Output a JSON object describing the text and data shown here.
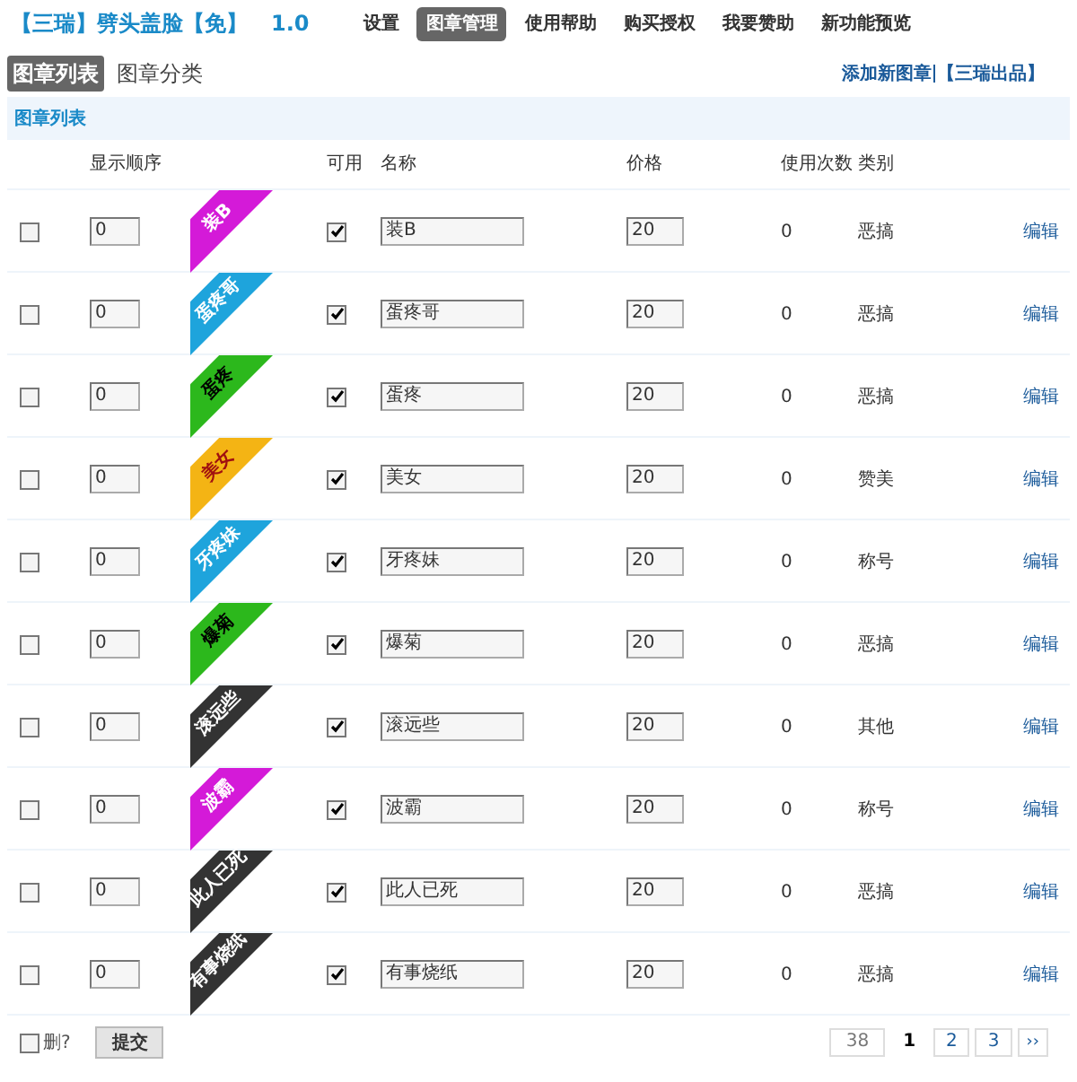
{
  "header": {
    "title": "【三瑞】劈头盖脸【免】",
    "version": "1.0",
    "nav": [
      {
        "label": "设置",
        "selected": false
      },
      {
        "label": "图章管理",
        "selected": true
      },
      {
        "label": "使用帮助",
        "selected": false
      },
      {
        "label": "购买授权",
        "selected": false
      },
      {
        "label": "我要赞助",
        "selected": false
      },
      {
        "label": "新功能预览",
        "selected": false
      }
    ]
  },
  "tabs": [
    {
      "label": "图章列表",
      "selected": true
    },
    {
      "label": "图章分类",
      "selected": false
    }
  ],
  "links": [
    "添加新图章",
    "【三瑞出品】"
  ],
  "section_title": "图章列表",
  "table": {
    "columns": [
      "显示顺序",
      "可用",
      "名称",
      "价格",
      "使用次数",
      "类别"
    ],
    "rows": [
      {
        "checked": false,
        "order": "0",
        "stamp": "装B",
        "color": "#d41ad8",
        "kind": "light",
        "enabled": true,
        "name": "装B",
        "price": "20",
        "uses": "0",
        "category": "恶搞",
        "action": "编辑"
      },
      {
        "checked": false,
        "order": "0",
        "stamp": "蛋疼哥",
        "color": "#1ea4dc",
        "kind": "light",
        "enabled": true,
        "name": "蛋疼哥",
        "price": "20",
        "uses": "0",
        "category": "恶搞",
        "action": "编辑"
      },
      {
        "checked": false,
        "order": "0",
        "stamp": "蛋疼",
        "color": "#2cb81c",
        "kind": "dark",
        "enabled": true,
        "name": "蛋疼",
        "price": "20",
        "uses": "0",
        "category": "恶搞",
        "action": "编辑"
      },
      {
        "checked": false,
        "order": "0",
        "stamp": "美女",
        "color": "#f4b414",
        "kind": "warm",
        "enabled": true,
        "name": "美女",
        "price": "20",
        "uses": "0",
        "category": "赞美",
        "action": "编辑"
      },
      {
        "checked": false,
        "order": "0",
        "stamp": "牙疼妹",
        "color": "#1ea4dc",
        "kind": "light",
        "enabled": true,
        "name": "牙疼妹",
        "price": "20",
        "uses": "0",
        "category": "称号",
        "action": "编辑"
      },
      {
        "checked": false,
        "order": "0",
        "stamp": "爆菊",
        "color": "#2cb81c",
        "kind": "dark",
        "enabled": true,
        "name": "爆菊",
        "price": "20",
        "uses": "0",
        "category": "恶搞",
        "action": "编辑"
      },
      {
        "checked": false,
        "order": "0",
        "stamp": "滚远些",
        "color": "#333333",
        "kind": "light",
        "enabled": true,
        "name": "滚远些",
        "price": "20",
        "uses": "0",
        "category": "其他",
        "action": "编辑"
      },
      {
        "checked": false,
        "order": "0",
        "stamp": "波霸",
        "color": "#d41ad8",
        "kind": "light",
        "enabled": true,
        "name": "波霸",
        "price": "20",
        "uses": "0",
        "category": "称号",
        "action": "编辑"
      },
      {
        "checked": false,
        "order": "0",
        "stamp": "此人已死",
        "color": "#333333",
        "kind": "light",
        "enabled": true,
        "name": "此人已死",
        "price": "20",
        "uses": "0",
        "category": "恶搞",
        "action": "编辑"
      },
      {
        "checked": false,
        "order": "0",
        "stamp": "有事烧纸",
        "color": "#333333",
        "kind": "light",
        "enabled": true,
        "name": "有事烧纸",
        "price": "20",
        "uses": "0",
        "category": "恶搞",
        "action": "编辑"
      }
    ]
  },
  "footer": {
    "delete_label": "删?",
    "delete_checked": false,
    "submit": "提交",
    "total": "38",
    "pages": [
      {
        "label": "1",
        "selected": true
      },
      {
        "label": "2",
        "selected": false
      },
      {
        "label": "3",
        "selected": false
      }
    ],
    "next": "››"
  }
}
